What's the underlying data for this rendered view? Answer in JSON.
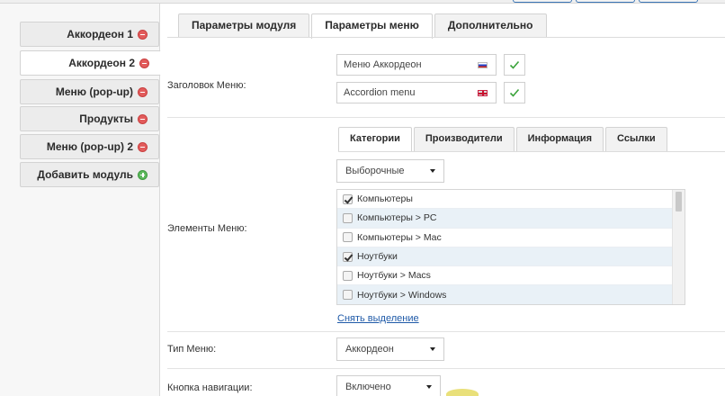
{
  "sidebar": {
    "items": [
      {
        "label": "Аккордеон 1",
        "active": false
      },
      {
        "label": "Аккордеон 2",
        "active": true
      },
      {
        "label": "Меню (pop-up)",
        "active": false
      },
      {
        "label": "Продукты",
        "active": false
      },
      {
        "label": "Меню (pop-up) 2",
        "active": false
      }
    ],
    "add_label": "Добавить модуль"
  },
  "tabs": [
    "Параметры модуля",
    "Параметры меню",
    "Дополнительно"
  ],
  "active_tab": "Параметры меню",
  "menu_title": {
    "label": "Заголовок Меню:",
    "values": [
      "Меню Аккордеон",
      "Accordion menu"
    ]
  },
  "menu_elements": {
    "label": "Элементы Меню:",
    "subtabs": [
      "Категории",
      "Производители",
      "Информация",
      "Ссылки"
    ],
    "active_subtab": "Категории",
    "filter_select": "Выборочные",
    "items": [
      {
        "label": "Компьютеры",
        "checked": true
      },
      {
        "label": "Компьютеры > PC",
        "checked": false
      },
      {
        "label": "Компьютеры > Mac",
        "checked": false
      },
      {
        "label": "Ноутбуки",
        "checked": true
      },
      {
        "label": "Ноутбуки > Macs",
        "checked": false
      },
      {
        "label": "Ноутбуки > Windows",
        "checked": false
      }
    ],
    "clear_link": "Снять выделение"
  },
  "menu_type": {
    "label": "Тип Меню:",
    "value": "Аккордеон"
  },
  "nav_button": {
    "label": "Кнопка навигации:",
    "value": "Включено"
  },
  "colors": {
    "accent": "#3a75b6",
    "remove": "#e25b5b",
    "add": "#5cb85c",
    "check": "#3aa33a",
    "link": "#1f5aa8",
    "row_alt": "#e9f1f7"
  }
}
